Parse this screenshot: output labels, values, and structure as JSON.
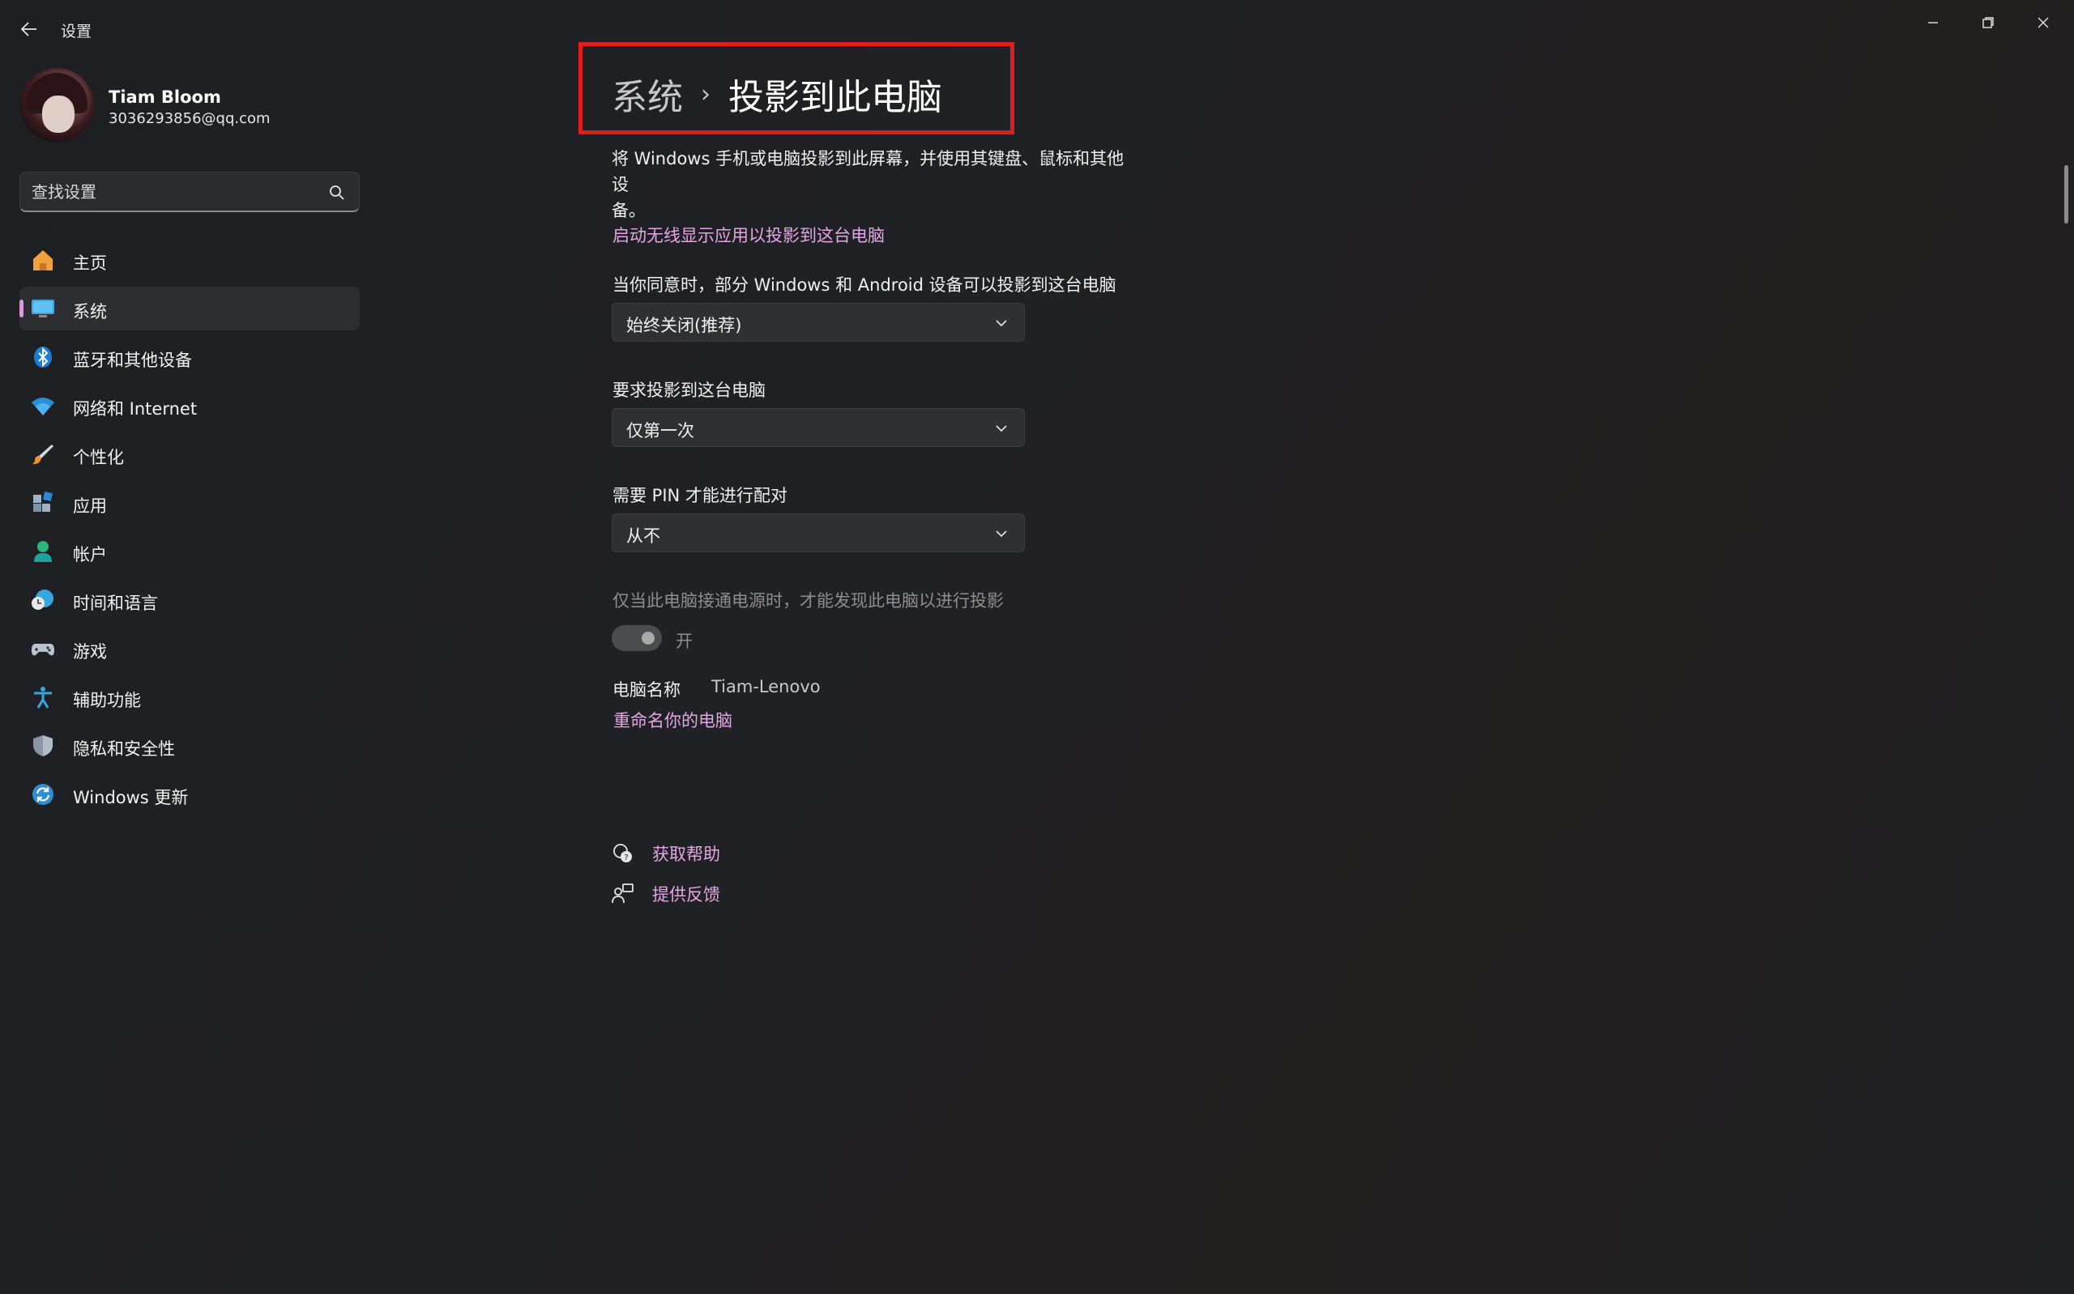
{
  "app": {
    "title": "设置"
  },
  "window_controls": {
    "minimize": "minimize-icon",
    "restore": "restore-icon",
    "close": "close-icon"
  },
  "profile": {
    "name": "Tiam Bloom",
    "email": "3036293856@qq.com"
  },
  "search": {
    "placeholder": "查找设置"
  },
  "sidebar": {
    "items": [
      {
        "label": "主页",
        "icon": "home-icon"
      },
      {
        "label": "系统",
        "icon": "monitor-icon",
        "active": true
      },
      {
        "label": "蓝牙和其他设备",
        "icon": "bluetooth-icon"
      },
      {
        "label": "网络和 Internet",
        "icon": "wifi-icon"
      },
      {
        "label": "个性化",
        "icon": "brush-icon"
      },
      {
        "label": "应用",
        "icon": "apps-icon"
      },
      {
        "label": "帐户",
        "icon": "account-icon"
      },
      {
        "label": "时间和语言",
        "icon": "globe-clock-icon"
      },
      {
        "label": "游戏",
        "icon": "gamepad-icon"
      },
      {
        "label": "辅助功能",
        "icon": "accessibility-icon"
      },
      {
        "label": "隐私和安全性",
        "icon": "shield-icon"
      },
      {
        "label": "Windows 更新",
        "icon": "update-icon"
      }
    ]
  },
  "main": {
    "breadcrumb": {
      "parent": "系统",
      "separator": "›",
      "current": "投影到此电脑"
    },
    "description_line1": "将 Windows 手机或电脑投影到此屏幕，并使用其键盘、鼠标和其他设",
    "description_line2": "备。",
    "launch_link": "启动无线显示应用以投影到这台电脑",
    "setting1": {
      "label": "当你同意时，部分 Windows 和 Android 设备可以投影到这台电脑",
      "value": "始终关闭(推荐)"
    },
    "setting2": {
      "label": "要求投影到这台电脑",
      "value": "仅第一次"
    },
    "setting3": {
      "label": "需要 PIN 才能进行配对",
      "value": "从不"
    },
    "power_setting": {
      "label": "仅当此电脑接通电源时，才能发现此电脑以进行投影",
      "toggle_text": "开",
      "toggle_on": true,
      "disabled": true
    },
    "pc_name": {
      "label": "电脑名称",
      "value": "Tiam-Lenovo"
    },
    "rename_link": "重命名你的电脑",
    "help": {
      "get_help": "获取帮助",
      "feedback": "提供反馈"
    }
  },
  "colors": {
    "accent_link": "#e4a6e4",
    "highlight_box": "#e01c1c",
    "background": "#1f2023"
  }
}
